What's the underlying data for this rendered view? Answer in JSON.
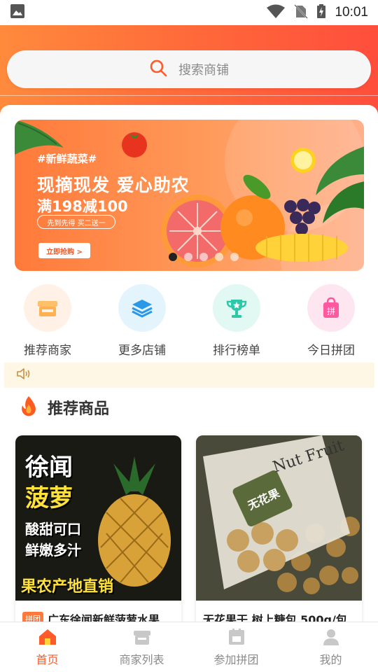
{
  "status_bar": {
    "time": "10:01"
  },
  "search": {
    "placeholder": "搜索商铺"
  },
  "banner": {
    "tag": "#新鲜蔬菜#",
    "title": "现摘现发 爱心助农",
    "subtitle": "满198减100",
    "pill": "先到先得 买二送一",
    "button": "立即抢购 >"
  },
  "categories": [
    {
      "label": "推荐商家",
      "icon": "shop-icon",
      "color": "#ffb06a"
    },
    {
      "label": "更多店铺",
      "icon": "stack-icon",
      "color": "#3aa8f0"
    },
    {
      "label": "排行榜单",
      "icon": "trophy-icon",
      "color": "#2ec8a8"
    },
    {
      "label": "今日拼团",
      "icon": "bag-icon",
      "color": "#ff5aa0"
    }
  ],
  "section": {
    "title": "推荐商品"
  },
  "products": [
    {
      "image_text_1": "徐闻",
      "image_text_2": "菠萝",
      "image_text_3": "酸甜可口",
      "image_text_4": "鲜嫩多汁",
      "image_text_5": "果农产地直销",
      "tag": "拼团",
      "title": "广东徐闻新鲜菠萝水果"
    },
    {
      "image_text_1": "Nut Fruit",
      "image_text_2": "无花果",
      "title": "无花果干 树上糖包 500g/包"
    }
  ],
  "bottom_nav": [
    {
      "label": "首页",
      "active": true
    },
    {
      "label": "商家列表",
      "active": false
    },
    {
      "label": "参加拼团",
      "active": false
    },
    {
      "label": "我的",
      "active": false
    }
  ],
  "colors": {
    "accent": "#ff5a2a",
    "header_start": "#ff8a3c",
    "header_end": "#ff4e3c"
  }
}
